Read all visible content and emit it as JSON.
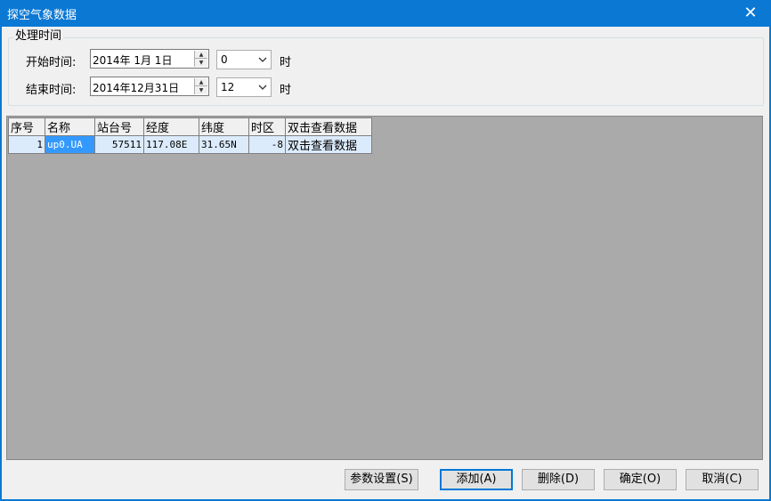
{
  "window": {
    "title": "探空气象数据",
    "close_glyph": "✕"
  },
  "time_group": {
    "label": "处理时间",
    "start": {
      "label": "开始时间:",
      "date": "2014年 1月 1日",
      "hour": "0",
      "unit": "时"
    },
    "end": {
      "label": "结束时间:",
      "date": "2014年12月31日",
      "hour": "12",
      "unit": "时"
    }
  },
  "table": {
    "columns": [
      "序号",
      "名称",
      "站台号",
      "经度",
      "纬度",
      "时区",
      "双击查看数据"
    ],
    "rows": [
      [
        "1",
        "up0.UA",
        "57511",
        "117.08E",
        "31.65N",
        "-8",
        "双击查看数据"
      ]
    ]
  },
  "buttons": {
    "params": "参数设置(S)",
    "add": "添加(A)",
    "delete": "删除(D)",
    "ok": "确定(O)",
    "cancel": "取消(C)"
  },
  "colors": {
    "titlebar": "#0b78d4",
    "selection": "#3399ff",
    "row_bg": "#dcebfc",
    "grid_bg": "#aaaaaa"
  }
}
